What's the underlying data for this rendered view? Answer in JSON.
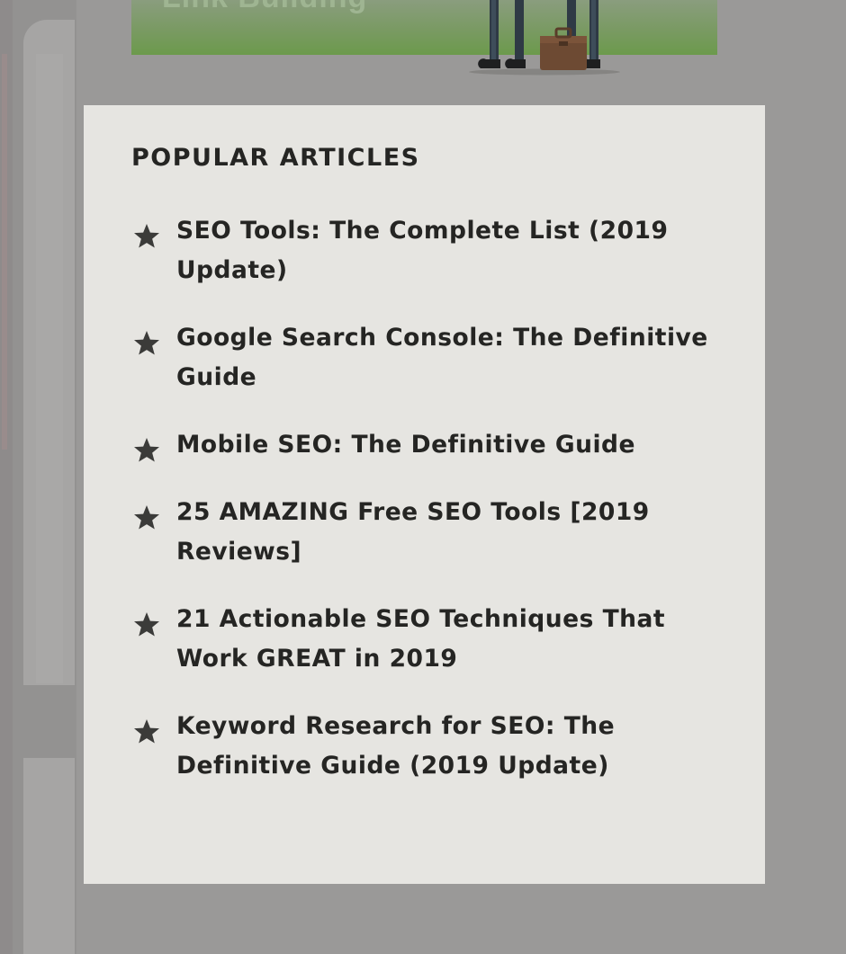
{
  "hero": {
    "title": "Link Building"
  },
  "popular": {
    "heading": "POPULAR ARTICLES",
    "articles": [
      {
        "title": "SEO Tools: The Complete List (2019 Update)"
      },
      {
        "title": "Google Search Console: The Definitive Guide"
      },
      {
        "title": "Mobile SEO: The Definitive Guide"
      },
      {
        "title": "25 AMAZING Free SEO Tools [2019 Reviews]"
      },
      {
        "title": "21 Actionable SEO Techniques That Work GREAT in 2019"
      },
      {
        "title": "Keyword Research for SEO: The Definitive Guide (2019 Update)"
      }
    ],
    "bullet_icon": "star-icon"
  },
  "colors": {
    "overlay": "#9a9998",
    "card_background": "#e6e5e1",
    "text": "#252523",
    "hero_green": "#6c9a4c"
  }
}
